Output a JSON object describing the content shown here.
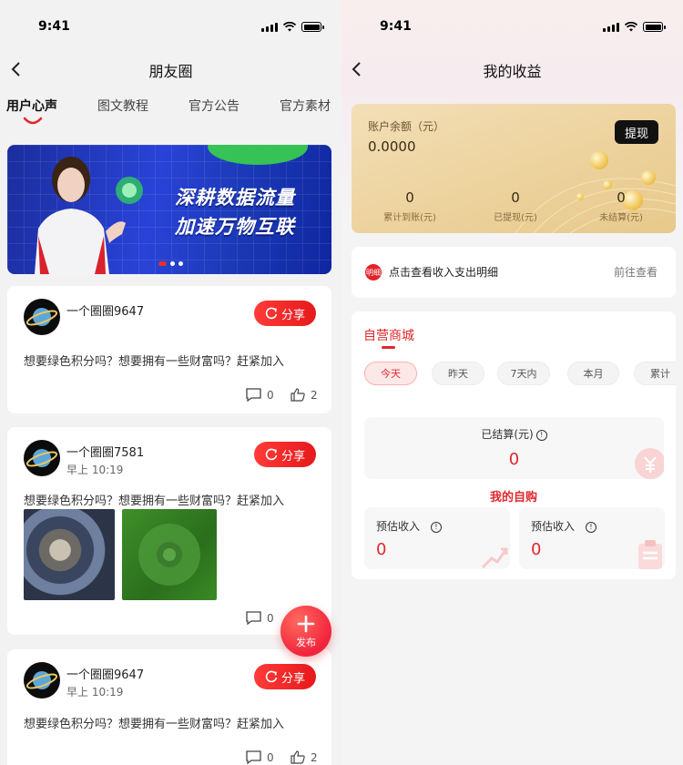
{
  "status": {
    "time": "9:41"
  },
  "left": {
    "title": "朋友圈",
    "tabs": [
      "用户心声",
      "图文教程",
      "官方公告",
      "官方素材"
    ],
    "banner": {
      "line1": "深耕数据流量",
      "line2": "加速万物互联"
    },
    "posts": [
      {
        "name": "一个圈圈9647",
        "time": "",
        "text": "想要绿色积分吗？想要拥有一些财富吗？赶紧加入",
        "comments": "0",
        "likes": "2",
        "share": "分享"
      },
      {
        "name": "一个圈圈7581",
        "time": "早上 10:19",
        "text": "想要绿色积分吗？想要拥有一些财富吗？赶紧加入",
        "comments": "0",
        "likes": "",
        "share": "分享"
      },
      {
        "name": "一个圈圈9647",
        "time": "早上 10:19",
        "text": "想要绿色积分吗？想要拥有一些财富吗？赶紧加入",
        "comments": "0",
        "likes": "2",
        "share": "分享"
      }
    ],
    "fab_label": "发布"
  },
  "right": {
    "title": "我的收益",
    "balance_label": "账户余额（元）",
    "balance": "0.0000",
    "withdraw": "提现",
    "stats": [
      {
        "value": "0",
        "label": "累计到账(元)"
      },
      {
        "value": "0",
        "label": "已提现(元)"
      },
      {
        "value": "0",
        "label": "未结算(元)"
      }
    ],
    "detail_icon": "明细",
    "detail_text": "点击查看收入支出明细",
    "detail_link": "前往查看",
    "mall_title": "自营商城",
    "filters": [
      "今天",
      "昨天",
      "7天内",
      "本月",
      "累计"
    ],
    "settled_label": "已结算(元)",
    "settled_value": "0",
    "self_title": "我的自购",
    "estimates": [
      {
        "label": "预估收入",
        "value": "0"
      },
      {
        "label": "预估收入",
        "value": "0"
      }
    ],
    "accent": "#e0272d"
  }
}
